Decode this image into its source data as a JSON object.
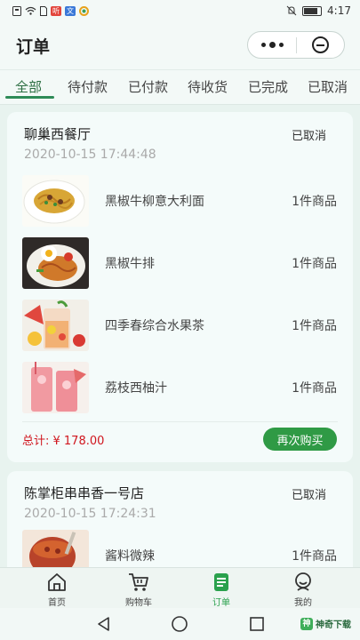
{
  "status_bar": {
    "time": "4:17",
    "left_icons": [
      "notification-icon",
      "wifi-icon",
      "sim-icon",
      "app-badge-icon",
      "app-badge-icon",
      "app-badge-icon"
    ],
    "app_badges": [
      "听",
      "文"
    ],
    "right_icons": [
      "mute-icon",
      "battery-icon"
    ]
  },
  "header": {
    "title": "订单"
  },
  "tabs": [
    {
      "label": "全部",
      "active": true
    },
    {
      "label": "待付款"
    },
    {
      "label": "已付款"
    },
    {
      "label": "待收货"
    },
    {
      "label": "已完成"
    },
    {
      "label": "已取消"
    }
  ],
  "orders": [
    {
      "shop": "聊巢西餐厅",
      "status": "已取消",
      "time": "2020-10-15 17:44:48",
      "items": [
        {
          "name": "黑椒牛柳意大利面",
          "qty": "1件商品",
          "image": "pasta"
        },
        {
          "name": "黑椒牛排",
          "qty": "1件商品",
          "image": "steak"
        },
        {
          "name": "四季春综合水果茶",
          "qty": "1件商品",
          "image": "fruit-tea"
        },
        {
          "name": "荔枝西柚汁",
          "qty": "1件商品",
          "image": "grapefruit-juice"
        }
      ],
      "total": "总计: ¥ 178.00",
      "action": "再次购买"
    },
    {
      "shop": "陈掌柜串串香一号店",
      "status": "已取消",
      "time": "2020-10-15 17:24:31",
      "items": [
        {
          "name": "酱料微辣",
          "qty": "1件商品",
          "image": "chili-sauce"
        }
      ]
    }
  ],
  "tabbar": [
    {
      "label": "首页",
      "icon": "home-icon"
    },
    {
      "label": "购物车",
      "icon": "cart-icon"
    },
    {
      "label": "订单",
      "icon": "orders-icon",
      "active": true
    },
    {
      "label": "我的",
      "icon": "profile-icon"
    }
  ],
  "watermark": "神奇下载",
  "colors": {
    "accent": "#2f9a45",
    "price": "#d0161e",
    "background": "#e8f3ef"
  }
}
